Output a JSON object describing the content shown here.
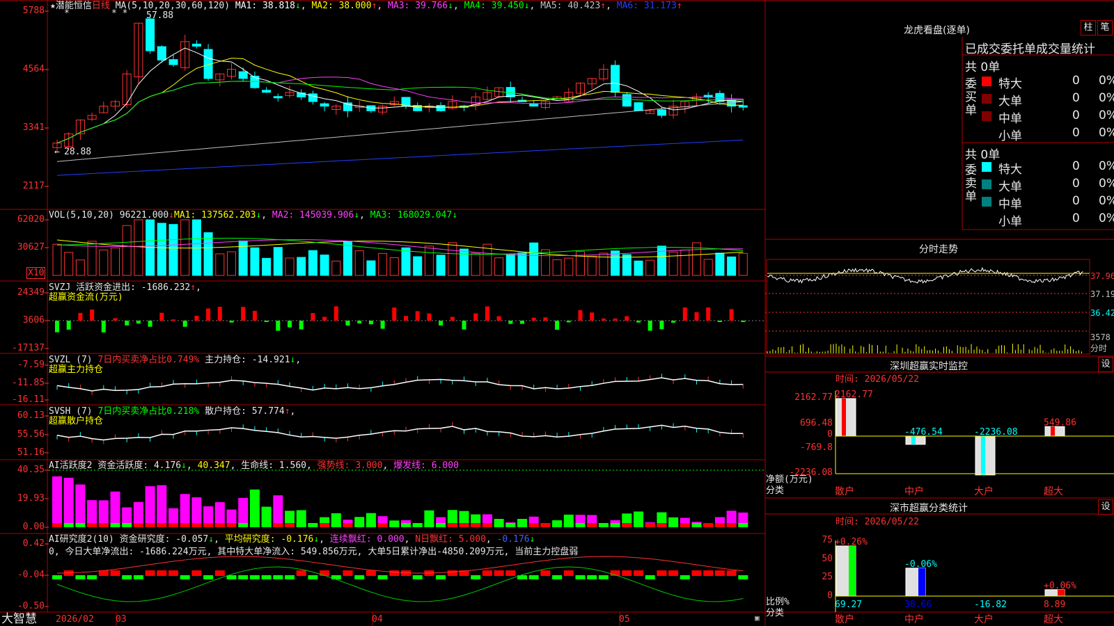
{
  "app_name": "大智慧",
  "stock": {
    "name": "潜能恒信",
    "period": "日线",
    "star": "★"
  },
  "main_chart": {
    "ma_label": "MA(5,10,20,30,60,120)",
    "ma": [
      {
        "label": "MA1: 38.818",
        "arrow": "↓",
        "color": "#ffffff"
      },
      {
        "label": "MA2: 38.000",
        "arrow": "↑",
        "color": "#ffff00"
      },
      {
        "label": "MA3: 39.766",
        "arrow": "↓",
        "color": "#ff40ff"
      },
      {
        "label": "MA4: 39.450",
        "arrow": "↓",
        "color": "#00ff00"
      },
      {
        "label": "MA5: 40.423",
        "arrow": "↑",
        "color": "#c0c0c0"
      },
      {
        "label": "MA6: 31.173",
        "arrow": "↑",
        "color": "#2040ff"
      }
    ],
    "y_labels": [
      "5788",
      "4564",
      "3341",
      "2117"
    ],
    "high_note": "57.88",
    "low_note": "28.88"
  },
  "vol_panel": {
    "label": "VOL(5,10,20)",
    "value": "96221.000",
    "ma": [
      {
        "label": "MA1: 137562.203",
        "arrow": "↓",
        "color": "#ffff00"
      },
      {
        "label": "MA2: 145039.906",
        "arrow": "↓",
        "color": "#ff40ff"
      },
      {
        "label": "MA3: 168029.047",
        "arrow": "↓",
        "color": "#00ff00"
      }
    ],
    "y_labels": [
      "62020",
      "30627"
    ],
    "unit": "X10"
  },
  "svzj_panel": {
    "label": "SVZJ",
    "desc": "活跃资金进出: -1686.232",
    "arrow": "↑",
    "subtitle": "超赢资金流(万元)",
    "y_labels": [
      "24349",
      "3606",
      "-17137"
    ]
  },
  "svzl_panel": {
    "label": "SVZL (7)",
    "desc1": "7日内买卖净占比0.749%",
    "desc2": "主力持仓: -14.921",
    "arrow": "↓",
    "subtitle": "超赢主力持仓",
    "y_labels": [
      "-7.59",
      "-11.85",
      "-16.11"
    ]
  },
  "svsh_panel": {
    "label": "SVSH (7)",
    "desc1": "7日内买卖净占比0.218%",
    "desc2": "散户持仓: 57.774",
    "arrow": "↑",
    "subtitle": "超赢散户持仓",
    "y_labels": [
      "60.13",
      "55.56",
      "51.16"
    ]
  },
  "ai_active": {
    "label": "AI活跃度2",
    "v1": "资金活跃度: 4.176",
    "v2": "40.347",
    "v3": "生命线: 1.560",
    "v4": "强势线: 3.000",
    "v5": "爆发线: 6.000",
    "y_labels": [
      "40.35",
      "19.93",
      "0.00"
    ]
  },
  "ai_research": {
    "label": "AI研究度2(10)",
    "v1": "资金研究度: -0.057",
    "v2": "平均研究度: -0.176",
    "v3": "连续飘红: 0.000",
    "v4": "N日飘红: 5.000",
    "v5": "-0.176",
    "summary": "0, 今日大单净流出: -1686.224万元, 其中特大单净流入: 549.856万元, 大单5日累计净出-4850.209万元, 当前主力控盘弱",
    "y_labels": [
      "0.42",
      "-0.04",
      "-0.50"
    ]
  },
  "x_axis": {
    "labels": [
      "2026/02",
      "03",
      "04",
      "05"
    ]
  },
  "right_panel": {
    "lhb_title": "龙虎看盘(逐单)",
    "btn_zhu": "柱",
    "btn_bi": "笔",
    "stats_title": "已成交委托单成交量统计",
    "buy_label": "委买单",
    "sell_label": "委卖单",
    "buy_total": "共 0单",
    "sell_total": "共 0单",
    "buy_rows": [
      {
        "name": "特大",
        "val": "0",
        "pct": "0%",
        "color": "#ff0000"
      },
      {
        "name": "大单",
        "val": "0",
        "pct": "0%",
        "color": "#800000"
      },
      {
        "name": "中单",
        "val": "0",
        "pct": "0%",
        "color": "#800000"
      },
      {
        "name": "小单",
        "val": "0",
        "pct": "0%",
        "color": ""
      }
    ],
    "sell_rows": [
      {
        "name": "特大",
        "val": "0",
        "pct": "0%",
        "color": "#00ffff"
      },
      {
        "name": "大单",
        "val": "0",
        "pct": "0%",
        "color": "#008080"
      },
      {
        "name": "中单",
        "val": "0",
        "pct": "0%",
        "color": "#008080"
      },
      {
        "name": "小单",
        "val": "0",
        "pct": "0%",
        "color": ""
      }
    ],
    "intraday_title": "分时走势",
    "intraday_labels": [
      "37.96",
      "37.19",
      "36.42",
      "3578",
      "分时"
    ],
    "monitor_title": "深圳超赢实时监控",
    "monitor_btn": "设",
    "monitor_time": "时间: 2026/05/22",
    "monitor_y": [
      "2162.77",
      "696.48",
      "0",
      "-769.8",
      "-2236.08"
    ],
    "monitor_bars": [
      {
        "cat": "散户",
        "value": 2162.77,
        "label": "2162.77"
      },
      {
        "cat": "中户",
        "value": -476.54,
        "label": "-476.54"
      },
      {
        "cat": "大户",
        "value": -2236.08,
        "label": "-2236.08"
      },
      {
        "cat": "超大",
        "value": 549.86,
        "label": "549.86"
      }
    ],
    "monitor_ylabel": "净额(万元)",
    "monitor_xlabel": "分类",
    "class_title": "深市超赢分类统计",
    "class_btn": "设",
    "class_time": "时间: 2026/05/22",
    "class_y": [
      "75",
      "50",
      "25",
      "0"
    ],
    "class_bars": [
      {
        "cat": "散户",
        "value": 0.26,
        "label": "+0.26%",
        "bottom": "69.27",
        "height": 69.27
      },
      {
        "cat": "中户",
        "value": -0.06,
        "label": "-0.06%",
        "bottom": "38.66",
        "height": 38.66
      },
      {
        "cat": "大户",
        "value": 0,
        "label": "",
        "bottom": "-16.82",
        "height": 0
      },
      {
        "cat": "超大",
        "value": 0.06,
        "label": "+0.06%",
        "bottom": "8.89",
        "height": 8.89
      }
    ],
    "class_ylabel": "比例%",
    "class_xlabel": "分类"
  }
}
